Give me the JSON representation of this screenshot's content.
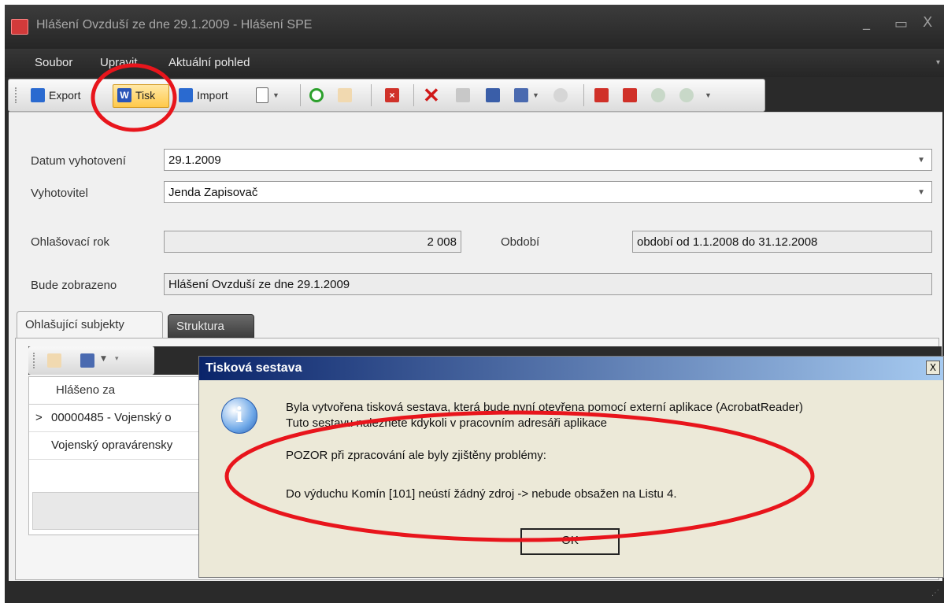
{
  "window": {
    "title": "Hlášení Ovzduší ze dne 29.1.2009 - Hlášení SPE",
    "minimize_glyph": "_",
    "maximize_glyph": "▭",
    "close_glyph": "X"
  },
  "menu": [
    "Soubor",
    "Upravit",
    "Aktuální pohled"
  ],
  "toolbar": {
    "export_label": "Export",
    "tisk_label": "Tisk",
    "import_label": "Import",
    "icons": [
      "export-icon",
      "word-icon",
      "import-icon",
      "new-document-icon",
      "refresh-icon",
      "hand-icon",
      "delete-record-icon",
      "delete-icon",
      "save-icon",
      "copy-icon",
      "paste-icon",
      "undo-icon",
      "calendar-icon",
      "stop-icon",
      "up-icon",
      "down-icon"
    ]
  },
  "form": {
    "datum_label": "Datum vyhotovení",
    "datum_value": "29.1.2009",
    "vyhotovitel_label": "Vyhotovitel",
    "vyhotovitel_value": "Jenda Zapisovač",
    "rok_label": "Ohlašovací rok",
    "rok_value": "2 008",
    "obdobi_label": "Období",
    "obdobi_value": "období od 1.1.2008 do 31.12.2008",
    "zobrazeno_label": "Bude zobrazeno",
    "zobrazeno_value": "Hlášení Ovzduší ze dne 29.1.2009"
  },
  "tabs": {
    "active": "Ohlašující subjekty",
    "inactive": "Struktura"
  },
  "grid": {
    "header": "Hlášeno za",
    "rows": [
      "00000485 - Vojenský o",
      "Vojenský opravárensky"
    ],
    "row_indicator": ">"
  },
  "dialog": {
    "title": "Tisková sestava",
    "close_glyph": "X",
    "line1": "Byla vytvořena tisková sestava, která bude nyní otevřena pomocí externí aplikace (AcrobatReader)",
    "line2": "Tuto sestavu naleznete kdykoli v pracovním adresáři aplikace",
    "line3": "POZOR při zpracování ale byly zjištěny problémy:",
    "line4": "Do výduchu Komín [101] neústí žádný zdroj -> nebude obsažen na Listu 4.",
    "ok_label": "OK",
    "info_glyph": "i"
  },
  "colors": {
    "annotation": "#e8151c",
    "dialog_title_start": "#0a246a",
    "dialog_title_end": "#a6caf0",
    "dialog_bg": "#ece9d8"
  }
}
